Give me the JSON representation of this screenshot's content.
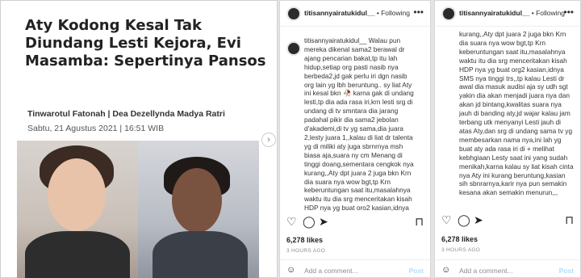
{
  "article": {
    "headline": "Aty Kodong Kesal Tak Diundang Lesti Kejora, Evi Masamba: Sepertinya Pansos",
    "authors": "Tinwarotul Fatonah | Dea Dezellynda Madya Ratri",
    "date": "Sabtu, 21 Agustus 2021 | 16:51 WIB",
    "next_icon": "chevron-right-icon"
  },
  "post2": {
    "username": "titisannyairatukidul__",
    "follow_label": " • Following",
    "menu_icon": "more-dots-icon",
    "caption": "titisannyairatukidul__ Walau pun\nmereka dikenal sama2 berawal dr\najang pencarian bakat,tp itu lah\nhidup,setiap org pasti nasib nya\nberbeda2,jd gak perlu iri dgn nasib\norg lain yg lbh beruntung.. sy liat Aty\nini kesal bkn 🥀 karna gak di undang\nlesti,tp dia ada rasa iri,krn lesti srg di\nundang di tv smntara dia jarang\npadahal pikir dia sama2 jebolan\nd'akademi,di tv yg sama,dia juara\n2,lesty juara 1,,kalau di liat dr talenta\nyg di miliki aty juga sbrnrnya msh\nbiasa aja,suara ny cm Menang di\ntinggi doang,sementara cengkok nya\nkurang,,Aty dpt juara 2 juga bkn Krn\ndia suara nya wow bgt,tp Krn\nkeberuntungan saat itu,masalahnya\nwaktu itu dia srg menceritakan kisah\nHDP nya yg buat oro2 kasian,idnya",
    "likes": "6,278 likes",
    "time_ago": "3 HOURS AGO",
    "comment_placeholder": "Add a comment...",
    "post_label": "Post"
  },
  "post3": {
    "username": "titisannyairatukidul__",
    "follow_label": " • Following",
    "menu_icon": "more-dots-icon",
    "caption": "kurang,,Aty dpt juara 2 juga bkn Krn\ndia suara nya wow bgt,tp Krn\nkeberuntungan saat itu,masalahnya\nwaktu itu dia srg menceritakan kisah\nHDP nya yg buat org2 kasian,idnya\nSMS nya tinggi trs,,tp kalau Lesti dr\nawal dia masuk audisi aja sy udh sgt\nyakin dia akan menjadi juara nya dan\nakan jd bintang,kwalitas suara nya\njauh di banding aty,jd wajar kalau jam\nterbang utk menyanyi Lesti jauh di\natas Aty,dan srg di undang sama tv yg\nmembesarkan nama nya,ini lah yg\nbuat aty ada rasa iri di + melihat\nkebhgiaan Lesty saat ini yang sudah\nmenikah,karna kalau sy liat kisah cinta\nnya Aty ini kurang beruntung,kasian\nsih sbnrarnya,karir nya pun semakin\nkesana akan semakin menurun,,,",
    "likes": "6,278 likes",
    "time_ago": "3 HOURS AGO",
    "comment_placeholder": "Add a comment...",
    "post_label": "Post"
  },
  "icons": {
    "like": "heart-icon",
    "comment": "comment-icon",
    "share": "share-icon",
    "save": "bookmark-icon",
    "emoji": "smiley-icon"
  }
}
